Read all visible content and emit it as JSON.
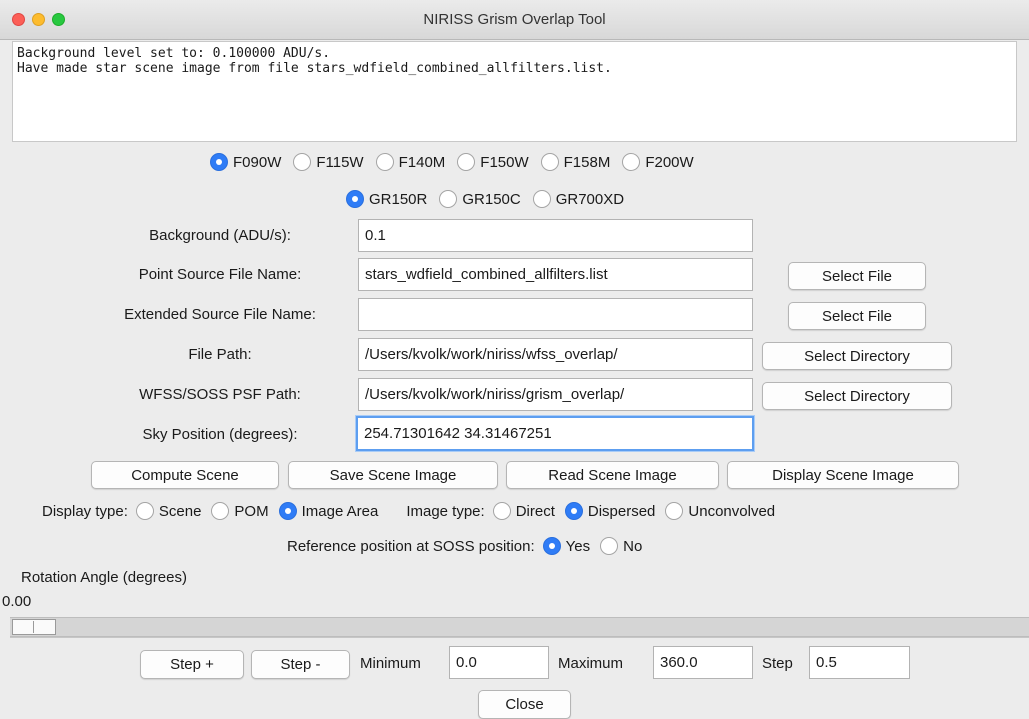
{
  "window": {
    "title": "NIRISS Grism Overlap Tool"
  },
  "log": {
    "text": "Background level set to: 0.100000 ADU/s.\nHave made star scene image from file stars_wdfield_combined_allfilters.list."
  },
  "filters": [
    {
      "label": "F090W",
      "selected": true
    },
    {
      "label": "F115W",
      "selected": false
    },
    {
      "label": "F140M",
      "selected": false
    },
    {
      "label": "F150W",
      "selected": false
    },
    {
      "label": "F158M",
      "selected": false
    },
    {
      "label": "F200W",
      "selected": false
    }
  ],
  "grisms": [
    {
      "label": "GR150R",
      "selected": true
    },
    {
      "label": "GR150C",
      "selected": false
    },
    {
      "label": "GR700XD",
      "selected": false
    }
  ],
  "form": {
    "background_label": "Background (ADU/s):",
    "background_value": "0.1",
    "point_source_label": "Point Source File Name:",
    "point_source_value": "stars_wdfield_combined_allfilters.list",
    "extended_source_label": "Extended Source File Name:",
    "extended_source_value": "",
    "file_path_label": "File Path:",
    "file_path_value": "/Users/kvolk/work/niriss/wfss_overlap/",
    "psf_path_label": "WFSS/SOSS PSF Path:",
    "psf_path_value": "/Users/kvolk/work/niriss/grism_overlap/",
    "sky_position_label": "Sky Position (degrees):",
    "sky_position_value": "254.71301642 34.31467251",
    "select_file_label": "Select File",
    "select_directory_label": "Select Directory"
  },
  "actions": {
    "compute": "Compute Scene",
    "save": "Save Scene Image",
    "read": "Read Scene Image",
    "display": "Display Scene Image"
  },
  "display_type": {
    "label": "Display type:",
    "options": [
      {
        "label": "Scene",
        "selected": false
      },
      {
        "label": "POM",
        "selected": false
      },
      {
        "label": "Image Area",
        "selected": true
      }
    ]
  },
  "image_type": {
    "label": "Image type:",
    "options": [
      {
        "label": "Direct",
        "selected": false
      },
      {
        "label": "Dispersed",
        "selected": true
      },
      {
        "label": "Unconvolved",
        "selected": false
      }
    ]
  },
  "reference": {
    "label": "Reference position at SOSS position:",
    "options": [
      {
        "label": "Yes",
        "selected": true
      },
      {
        "label": "No",
        "selected": false
      }
    ]
  },
  "rotation": {
    "label": "Rotation Angle (degrees)",
    "value": "0.00",
    "slider_fraction": 0.0
  },
  "controls": {
    "step_plus": "Step +",
    "step_minus": "Step -",
    "minimum_label": "Minimum",
    "minimum_value": "0.0",
    "maximum_label": "Maximum",
    "maximum_value": "360.0",
    "step_label": "Step",
    "step_value": "0.5",
    "close": "Close"
  },
  "colors": {
    "accent": "#2f7cf6",
    "close_light": "#fc5f57",
    "minimize_light": "#fdbc2e",
    "zoom_light": "#28c840"
  }
}
